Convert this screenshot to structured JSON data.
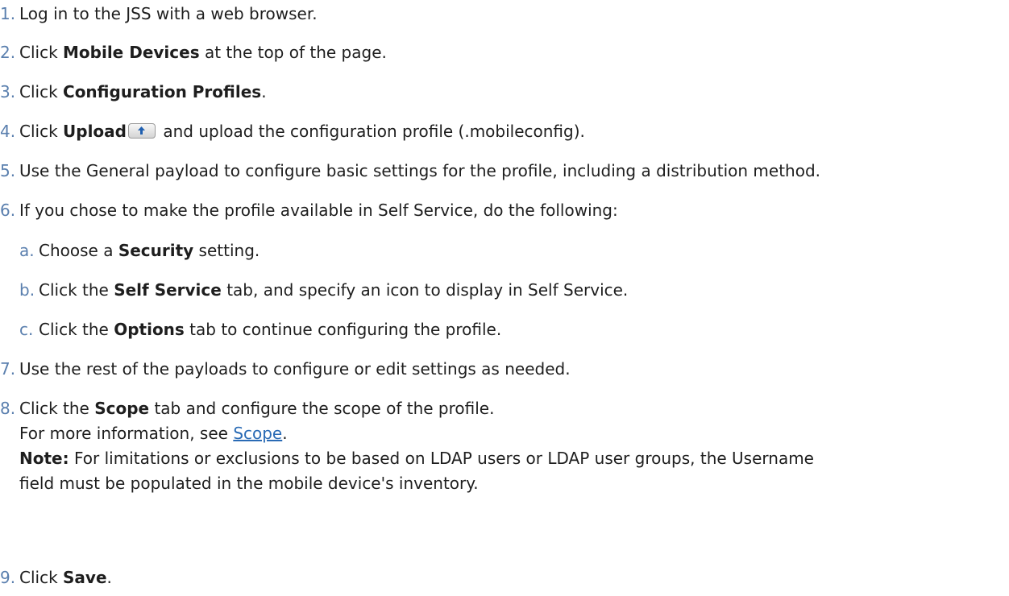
{
  "steps": [
    {
      "num": "1.",
      "parts": [
        "Log in to the JSS with a web browser."
      ]
    },
    {
      "num": "2.",
      "pre": "Click ",
      "bold": "Mobile Devices",
      "post": " at the top of the page."
    },
    {
      "num": "3.",
      "pre": "Click ",
      "bold": "Configuration Profiles",
      "post": "."
    },
    {
      "num": "4.",
      "pre": "Click ",
      "bold": "Upload",
      "post": " and upload the configuration profile (.mobileconfig)."
    },
    {
      "num": "5.",
      "text": "Use the General payload to configure basic settings for the profile, including a distribution method."
    },
    {
      "num": "6.",
      "text": "If you chose to make the profile available in Self Service, do the following:"
    },
    {
      "num": "a.",
      "pre": "Choose a ",
      "bold": "Security",
      "post": " setting."
    },
    {
      "num": "b.",
      "pre": "Click the ",
      "bold": "Self Service",
      "post": " tab, and specify an icon to display in Self Service."
    },
    {
      "num": "c.",
      "pre": "Click the ",
      "bold": "Options",
      "post": " tab to continue configuring the profile."
    },
    {
      "num": "7.",
      "text": "Use the rest of the payloads to configure or edit settings as needed."
    },
    {
      "num": "8.",
      "pre": "Click the ",
      "bold": "Scope",
      "post": " tab and configure the scope of the profile.",
      "more_pre": "For more information, see ",
      "link": "Scope",
      "more_post": ".",
      "note_label": "Note:",
      "note_text": " For limitations or exclusions to be based on LDAP users or LDAP user groups, the Username",
      "note_text2": "field must be populated in the mobile device's inventory."
    },
    {
      "num": "9.",
      "pre": "Click ",
      "bold": "Save",
      "post": "."
    }
  ],
  "icons": {
    "upload": "upload-arrow-icon"
  }
}
